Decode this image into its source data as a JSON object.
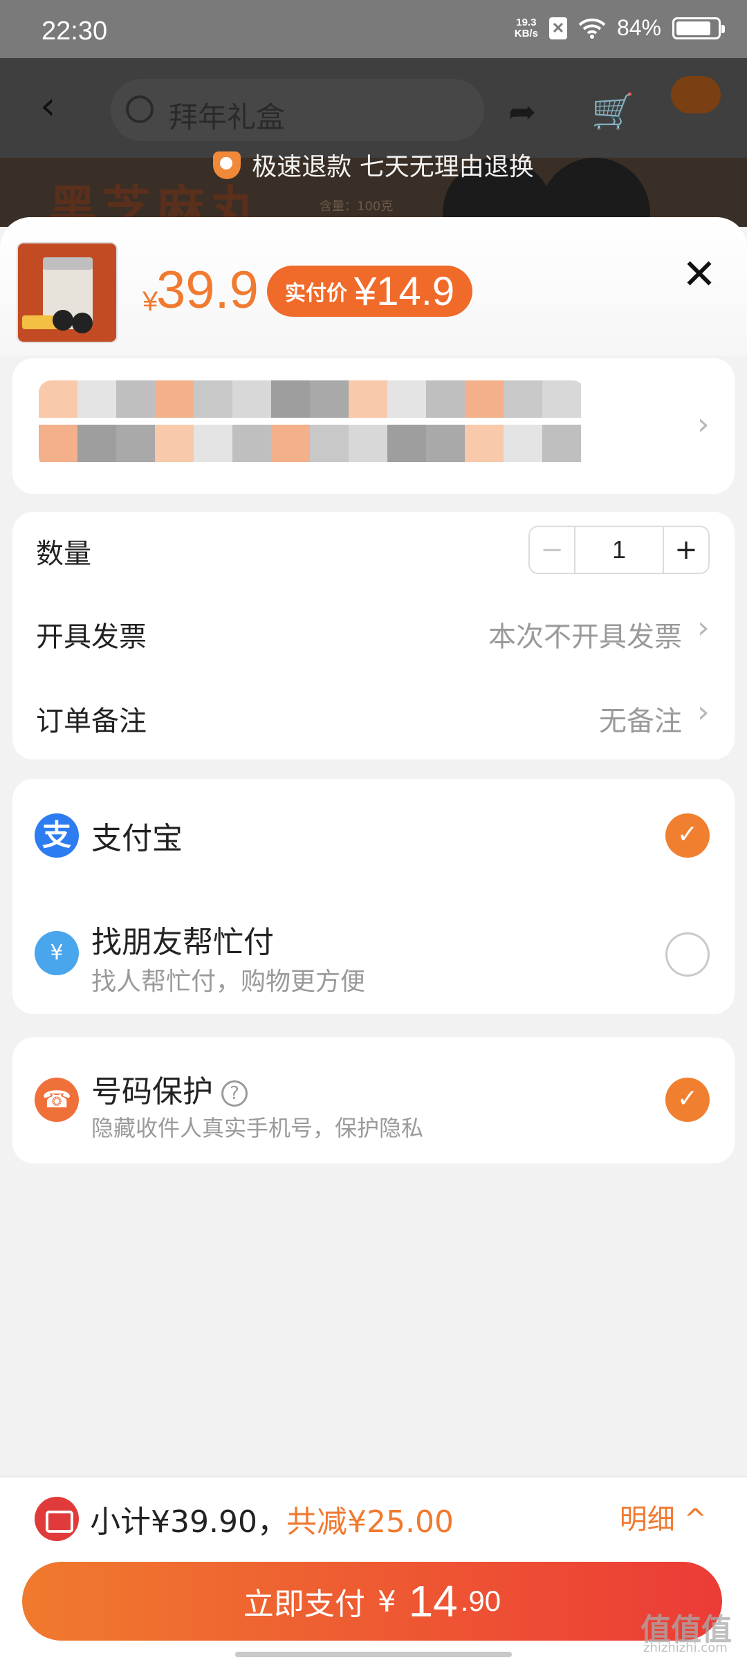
{
  "status_bar": {
    "time": "22:30",
    "net_speed_value": "19.3",
    "net_speed_unit": "KB/s",
    "sim_label": "✕",
    "battery": "84%",
    "battery_level": 0.84
  },
  "background_page": {
    "search_placeholder": "拜年礼盒",
    "banner_title": "黑芝麻丸",
    "banner_note": "含量：100克",
    "refund_banner": "极速退款 七天无理由退换"
  },
  "product": {
    "price_currency": "¥",
    "price": "39.9",
    "pay_price_label": "实付价",
    "pay_price": "¥14.9"
  },
  "address": {
    "blurred": true,
    "blur_palette": [
      "#f8c9aa",
      "#d8d8d8",
      "#bfbfbf",
      "#a9a9a9",
      "#c8c8c8",
      "#e4e4e4",
      "#9e9e9e",
      "#f3b08b"
    ]
  },
  "order_info": {
    "quantity_label": "数量",
    "quantity_value": "1",
    "minus": "−",
    "plus": "+",
    "invoice_label": "开具发票",
    "invoice_value": "本次不开具发票",
    "remark_label": "订单备注",
    "remark_value": "无备注"
  },
  "payment_methods": [
    {
      "title": "支付宝",
      "subtitle": "",
      "icon": "alipay-icon",
      "icon_glyph": "支",
      "selected": true
    },
    {
      "title": "找朋友帮忙付",
      "subtitle": "找人帮忙付，购物更方便",
      "icon": "friend-pay-icon",
      "icon_glyph": "¥",
      "selected": false
    }
  ],
  "number_protection": {
    "title": "号码保护",
    "help": "?",
    "subtitle": "隐藏收件人真实手机号，保护隐私",
    "icon_glyph": "☎",
    "selected": true
  },
  "summary": {
    "subtotal": "小计¥39.90，",
    "discount": "共减¥25.00",
    "detail": "明细 ^"
  },
  "pay_button": {
    "label": "立即支付",
    "currency": "¥",
    "amount_int": "14",
    "amount_dec": ".90"
  },
  "watermark": {
    "text": "值值值",
    "sub": "zhizhizhi.com"
  },
  "colors": {
    "accent": "#f07a30",
    "pay_gradient_start": "#f07a2e",
    "pay_gradient_end": "#ec3b36",
    "alipay_blue": "#2d7df0"
  }
}
